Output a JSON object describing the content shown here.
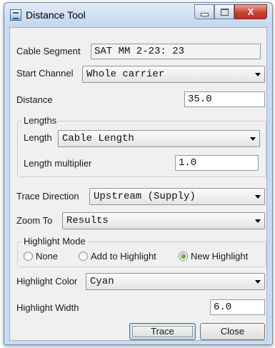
{
  "window": {
    "title": "Distance Tool",
    "close_glyph": "X"
  },
  "form": {
    "cable_segment_label": "Cable Segment",
    "cable_segment_value": "SAT MM 2-23: 23",
    "start_channel_label": "Start Channel",
    "start_channel_value": "Whole carrier",
    "distance_label": "Distance",
    "distance_value": "35.0",
    "lengths_group_title": "Lengths",
    "length_label": "Length",
    "length_value": "Cable Length",
    "length_multiplier_label": "Length multiplier",
    "length_multiplier_value": "1.0",
    "trace_direction_label": "Trace Direction",
    "trace_direction_value": "Upstream (Supply)",
    "zoom_to_label": "Zoom To",
    "zoom_to_value": "Results",
    "highlight_mode_title": "Highlight Mode",
    "highlight_modes": [
      {
        "label": "None",
        "selected": false
      },
      {
        "label": "Add to Highlight",
        "selected": false
      },
      {
        "label": "New Highlight",
        "selected": true
      }
    ],
    "highlight_color_label": "Highlight Color",
    "highlight_color_value": "Cyan",
    "highlight_width_label": "Highlight Width",
    "highlight_width_value": "6.0"
  },
  "buttons": {
    "trace": "Trace",
    "close": "Close"
  }
}
